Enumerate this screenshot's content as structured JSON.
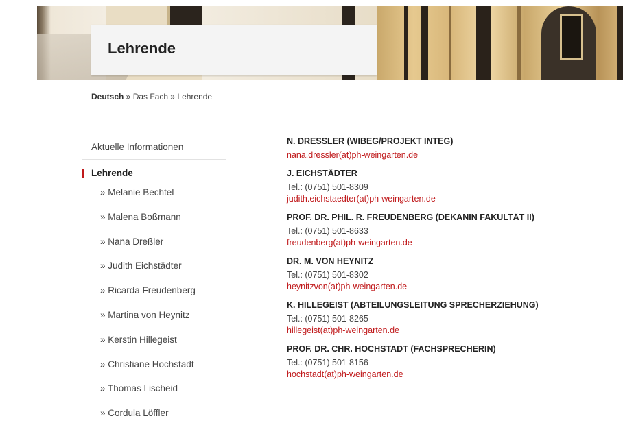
{
  "page_title": "Lehrende",
  "breadcrumb": {
    "root": "Deutsch",
    "sep1": " » ",
    "item1": "Das Fach",
    "sep2": " » ",
    "item2": "Lehrende"
  },
  "sidebar": {
    "top_item": "Aktuelle Informationen",
    "active_item": "Lehrende",
    "sub_items": [
      "» Melanie Bechtel",
      "» Malena Boßmann",
      "» Nana Dreßler",
      "» Judith Eichstädter",
      "» Ricarda Freudenberg",
      "» Martina von Heynitz",
      "» Kerstin Hillegeist",
      "» Christiane Hochstadt",
      "» Thomas Lischeid",
      "» Cordula Löffler"
    ]
  },
  "entries": [
    {
      "name": "N. Dressler (WiBeG/Projekt InteG)",
      "tel": "",
      "mail": "nana.dressler(at)ph-weingarten.de"
    },
    {
      "name": "J. Eichstädter",
      "tel": "Tel.: (0751) 501-8309",
      "mail": "judith.eichstaedter(at)ph-weingarten.de"
    },
    {
      "name": "Prof. Dr. phil. R. Freudenberg (Dekanin Fakultät II)",
      "tel": "Tel.: (0751) 501-8633",
      "mail": "freudenberg(at)ph-weingarten.de"
    },
    {
      "name": "Dr. M. von Heynitz",
      "tel": "Tel.: (0751) 501-8302",
      "mail": "heynitzvon(at)ph-weingarten.de"
    },
    {
      "name": "K. Hillegeist (Abteilungsleitung Sprecherziehung)",
      "tel": "Tel.: (0751) 501-8265",
      "mail": "hillegeist(at)ph-weingarten.de"
    },
    {
      "name": "Prof. Dr. Chr. Hochstadt (Fachsprecherin)",
      "tel": "Tel.: (0751) 501-8156",
      "mail": "hochstadt(at)ph-weingarten.de"
    }
  ],
  "colors": {
    "accent": "#c0191b",
    "title_box": "#f4f4f4"
  }
}
